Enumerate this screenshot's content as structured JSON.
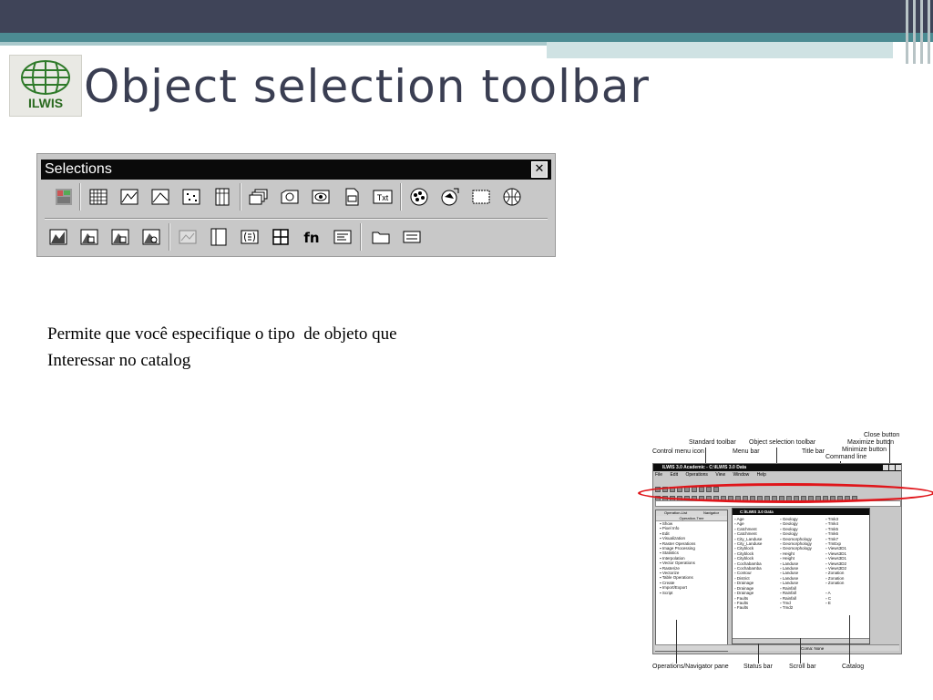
{
  "slide": {
    "title": "Object selection toolbar",
    "logo_text": "ILWIS",
    "description_line1": "Permite que você especifique o tipo  de objeto que",
    "description_line2": "Interessar no catalog"
  },
  "colors": {
    "header_dark": "#3f4458",
    "header_teal": "#4c8b92",
    "title_text": "#3a3e52",
    "highlight_oval": "#e0151a"
  },
  "selections_toolbar": {
    "title": "Selections",
    "close_symbol": "✕",
    "row1_icons": [
      "all-objects-icon",
      "raster-map-icon",
      "polygon-map-icon",
      "segment-map-icon",
      "point-map-icon",
      "table-icon",
      "map-list-icon",
      "map-view-icon",
      "annotation-text-icon",
      "domain-icon",
      "text-icon",
      "representation-icon",
      "georeference-icon",
      "coordinate-system-icon",
      "sample-set-icon"
    ],
    "row2_icons": [
      "histogram-icon",
      "polygon-histogram-icon",
      "segment-histogram-icon",
      "point-histogram-icon",
      "stereopair-icon",
      "matrix-icon",
      "filter-icon",
      "2d-table-icon",
      "function-icon",
      "script-icon",
      "folder-icon",
      "layout-icon"
    ],
    "row2_fn_label": "fn",
    "row1_txt_label": "Txt"
  },
  "annotated_screenshot": {
    "labels": {
      "close_button": "Close button",
      "standard_toolbar": "Standard toolbar",
      "object_selection_toolbar": "Object selection toolbar",
      "maximize_button": "Maximize button",
      "minimize_button": "Minimize button",
      "control_menu_icon": "Control menu icon",
      "menu_bar": "Menu bar",
      "title_bar": "Title bar",
      "command_line": "Command line",
      "operations_navigator_pane": "Operations/Navigator pane",
      "status_bar": "Status bar",
      "scroll_bar": "Scroll bar",
      "catalog": "Catalog"
    },
    "window_title": "ILWIS 3.0 Academic - C:\\ILWIS 3.0 Data",
    "menu": [
      "File",
      "Edit",
      "Operations",
      "View",
      "Window",
      "Help"
    ],
    "nav_tabs": [
      "Operation-List",
      "Navigator"
    ],
    "nav_header": "Operation-Tree",
    "nav_items": [
      "Show",
      "Pixel Info",
      "Edit",
      "Visualization",
      "Raster Operations",
      "Image Processing",
      "Statistics",
      "Interpolation",
      "Vector Operations",
      "Rasterize",
      "Vectorize",
      "Table Operations",
      "Create",
      "Import/Export",
      "Script"
    ],
    "catalog_title": "C:\\ILWIS 3.0 Data",
    "catalog_col1": [
      "Age",
      "Age",
      "Catchment",
      "Catchment",
      "City_Landuse",
      "City_Landuse",
      "Cityblock",
      "Cityblock",
      "Cityblock",
      "Cochabamba",
      "Cochabamba",
      "Contour",
      "District",
      "Drainage",
      "Drainage",
      "Drainage",
      "Faults",
      "Faults",
      "Faults"
    ],
    "catalog_col2": [
      "Geology",
      "Geology",
      "Geology",
      "Geology",
      "Geomorphology",
      "Geomorphology",
      "Geomorphology",
      "Height",
      "Height",
      "Landuse",
      "Landuse",
      "Landuse",
      "Landuse",
      "Landuse",
      "Rainfall",
      "Rainfall",
      "Rainfall",
      "Tmd",
      "Tmd2"
    ],
    "catalog_col3": [
      "Tmk3",
      "Tmk4",
      "Tmk5",
      "Tmk6",
      "Tmk7",
      "TmExp",
      "Views3D1",
      "Views3D1",
      "Views3D1",
      "Views3D2",
      "Views3D2",
      "Zonation",
      "Zonation",
      "Zonation",
      "",
      "A",
      "C",
      "E",
      ""
    ],
    "status_text": "Coma: None"
  }
}
